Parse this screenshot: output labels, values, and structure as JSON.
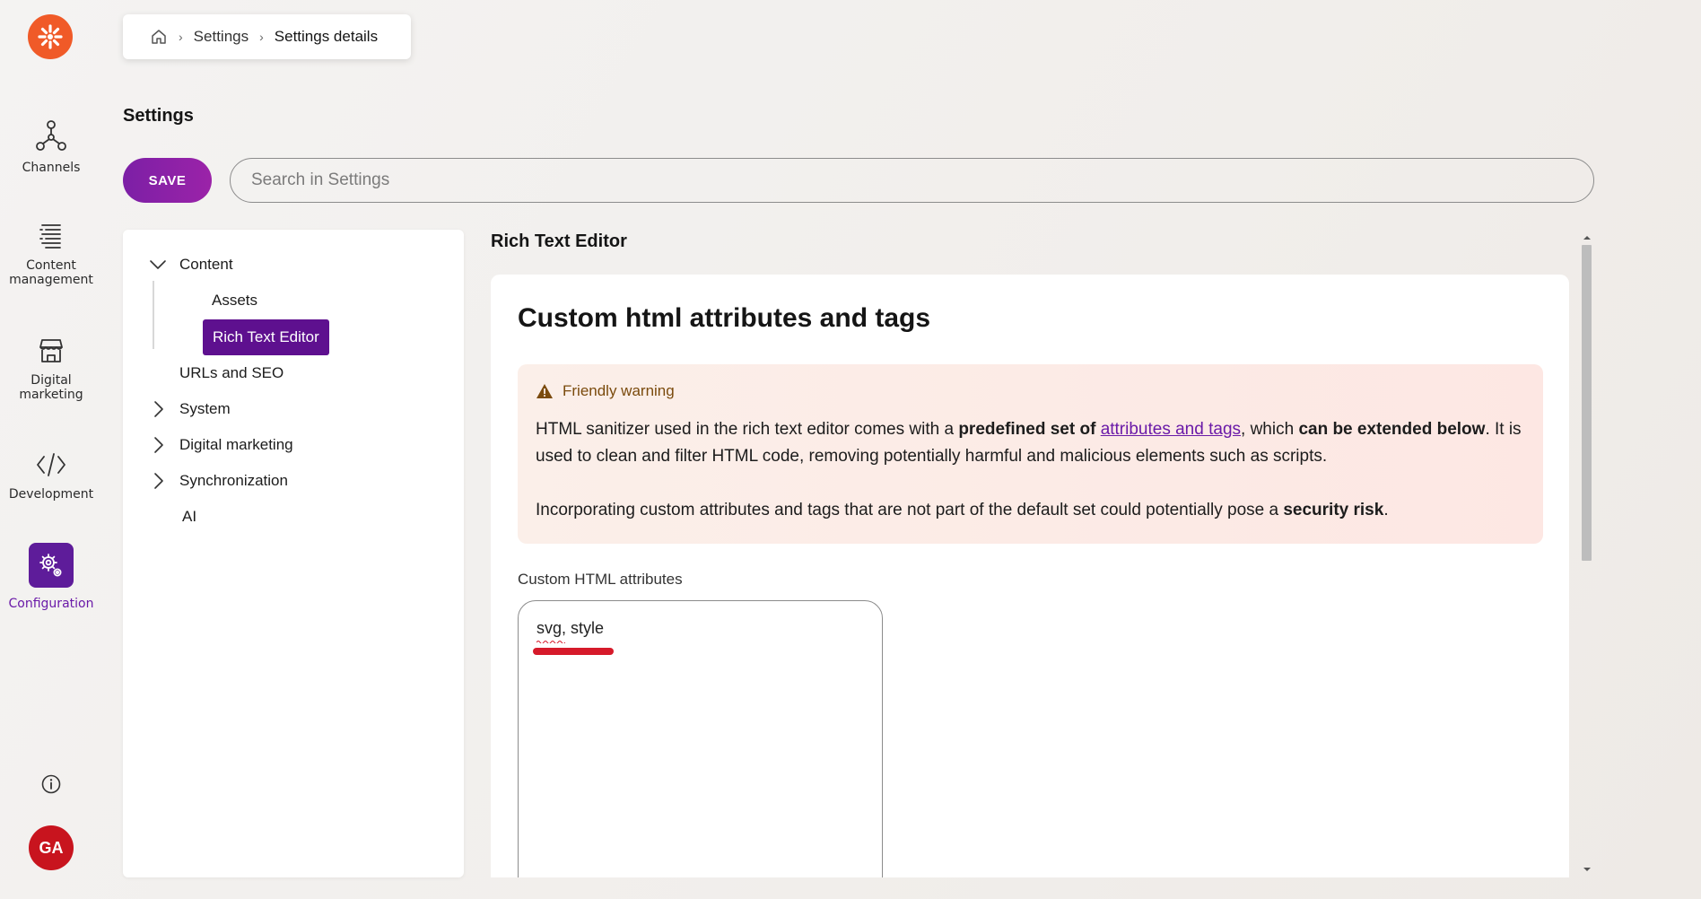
{
  "app": {
    "rail": [
      {
        "key": "channels",
        "label": "Channels"
      },
      {
        "key": "content",
        "label": "Content\nmanagement"
      },
      {
        "key": "digital",
        "label": "Digital\nmarketing"
      },
      {
        "key": "development",
        "label": "Development"
      },
      {
        "key": "configuration",
        "label": "Configuration"
      }
    ],
    "avatar_initials": "GA",
    "brand_color": "#f05a28",
    "accent_color": "#5e108f"
  },
  "breadcrumb": {
    "home_icon": "home-icon",
    "items": [
      "Settings",
      "Settings details"
    ]
  },
  "header": {
    "title": "Settings",
    "save_label": "SAVE",
    "search_placeholder": "Search in Settings"
  },
  "tree": {
    "content": "Content",
    "assets": "Assets",
    "rich_text_editor": "Rich Text Editor",
    "urls_seo": "URLs and SEO",
    "system": "System",
    "digital_marketing": "Digital marketing",
    "synchronization": "Synchronization",
    "ai": "AI"
  },
  "main": {
    "section_title": "Rich Text Editor",
    "card_title": "Custom html attributes and tags",
    "warning": {
      "heading": "Friendly warning",
      "p1_a": "HTML sanitizer used in the rich text editor comes with a ",
      "p1_b": "predefined set of",
      "p1_c": " ",
      "p1_link": "attributes and tags",
      "p1_d": ", which ",
      "p1_e": "can be extended below",
      "p1_f": ". It is used to clean and filter HTML code, removing potentially harmful and malicious elements such as scripts.",
      "p2_a": "Incorporating custom attributes and tags that are not part of the default set could potentially pose a ",
      "p2_b": "security risk",
      "p2_c": "."
    },
    "custom_attrs_label": "Custom HTML attributes",
    "custom_attrs_value": "svg, style"
  }
}
